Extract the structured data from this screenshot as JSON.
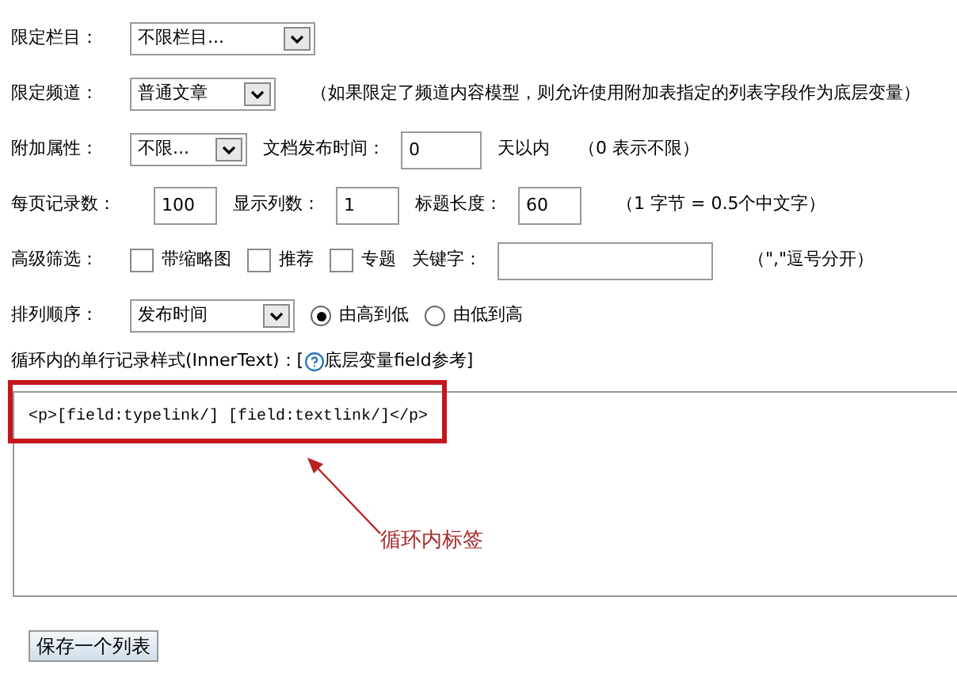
{
  "rows": [
    {
      "items": [
        {
          "kind": "label",
          "text": "限定栏目："
        },
        {
          "kind": "select",
          "value": "不限栏目..."
        }
      ]
    },
    {
      "items": [
        {
          "kind": "label",
          "text": "限定频道："
        },
        {
          "kind": "select",
          "value": "普通文章"
        },
        {
          "kind": "note",
          "text": "（如果限定了频道内容模型，则允许使用附加表指定的列表字段作为底层变量）"
        }
      ]
    },
    {
      "items": [
        {
          "kind": "label",
          "text": "附加属性："
        },
        {
          "kind": "select",
          "value": "不限..."
        },
        {
          "kind": "label",
          "text": "文档发布时间："
        },
        {
          "kind": "input",
          "value": "0"
        },
        {
          "kind": "label",
          "text": "天以内"
        },
        {
          "kind": "note",
          "text": "（0 表示不限）"
        }
      ]
    },
    {
      "items": [
        {
          "kind": "label",
          "text": "每页记录数："
        },
        {
          "kind": "input",
          "value": "100"
        },
        {
          "kind": "label",
          "text": "显示列数："
        },
        {
          "kind": "input",
          "value": "1"
        },
        {
          "kind": "label",
          "text": "标题长度："
        },
        {
          "kind": "input",
          "value": "60"
        },
        {
          "kind": "note",
          "text": "（1 字节 = 0.5个中文字）"
        }
      ]
    },
    {
      "items": [
        {
          "kind": "label",
          "text": "高级筛选："
        },
        {
          "kind": "checkbox",
          "text": "带缩略图",
          "checked": false
        },
        {
          "kind": "checkbox",
          "text": "推荐",
          "checked": false
        },
        {
          "kind": "checkbox",
          "text": "专题",
          "checked": false
        },
        {
          "kind": "label",
          "text": "关键字："
        },
        {
          "kind": "input",
          "value": ""
        },
        {
          "kind": "note",
          "text": "（\",\"逗号分开）"
        }
      ]
    },
    {
      "items": [
        {
          "kind": "label",
          "text": "排列顺序："
        },
        {
          "kind": "select",
          "value": "发布时间"
        },
        {
          "kind": "radio",
          "text": "由高到低",
          "selected": true
        },
        {
          "kind": "radio",
          "text": "由低到高",
          "selected": false
        }
      ]
    }
  ],
  "inner_text": {
    "label": "循环内的单行记录样式(InnerText)：[",
    "link": "底层变量field参考]",
    "value": "<p>[field:typelink/] [field:textlink/]</p>"
  },
  "annotation": {
    "text": "循环内标签"
  },
  "save_button": "保存一个列表"
}
